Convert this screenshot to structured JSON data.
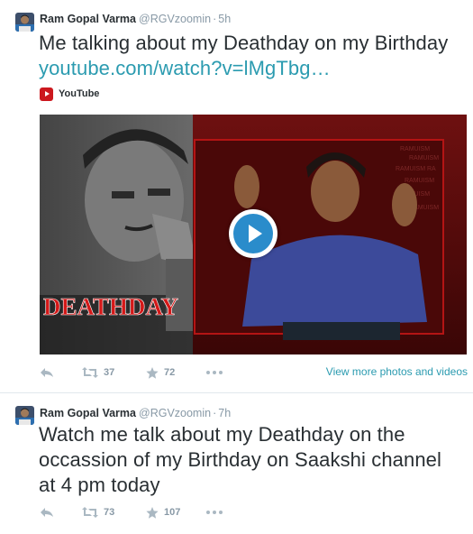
{
  "tweets": [
    {
      "fullname": "Ram Gopal Varma",
      "username": "@RGVzoomin",
      "separator": "·",
      "time": "5h",
      "text": "Me talking about my Deathday on my Birthday ",
      "link": "youtube.com/watch?v=lMgTbg…",
      "card_source": "YouTube",
      "media": {
        "title_overlay": "DEATHDAY",
        "side_text": "RAMUISM"
      },
      "retweets": "37",
      "favorites": "72",
      "view_more": "View more photos and videos"
    },
    {
      "fullname": "Ram Gopal Varma",
      "username": "@RGVzoomin",
      "separator": "·",
      "time": "7h",
      "text": "Watch me talk about my Deathday on the occassion of my Birthday on Saakshi channel at 4 pm today",
      "retweets": "73",
      "favorites": "107"
    }
  ],
  "colors": {
    "link": "#2b9bb0",
    "text": "#292f33",
    "muted": "#8899a6",
    "youtube_red": "#cc181e",
    "play_blue": "#2a8ccb"
  },
  "icons": {
    "reply": "reply-icon",
    "retweet": "retweet-icon",
    "favorite": "star-icon",
    "more": "more-dots-icon",
    "play": "play-icon",
    "youtube": "youtube-logo-icon"
  }
}
